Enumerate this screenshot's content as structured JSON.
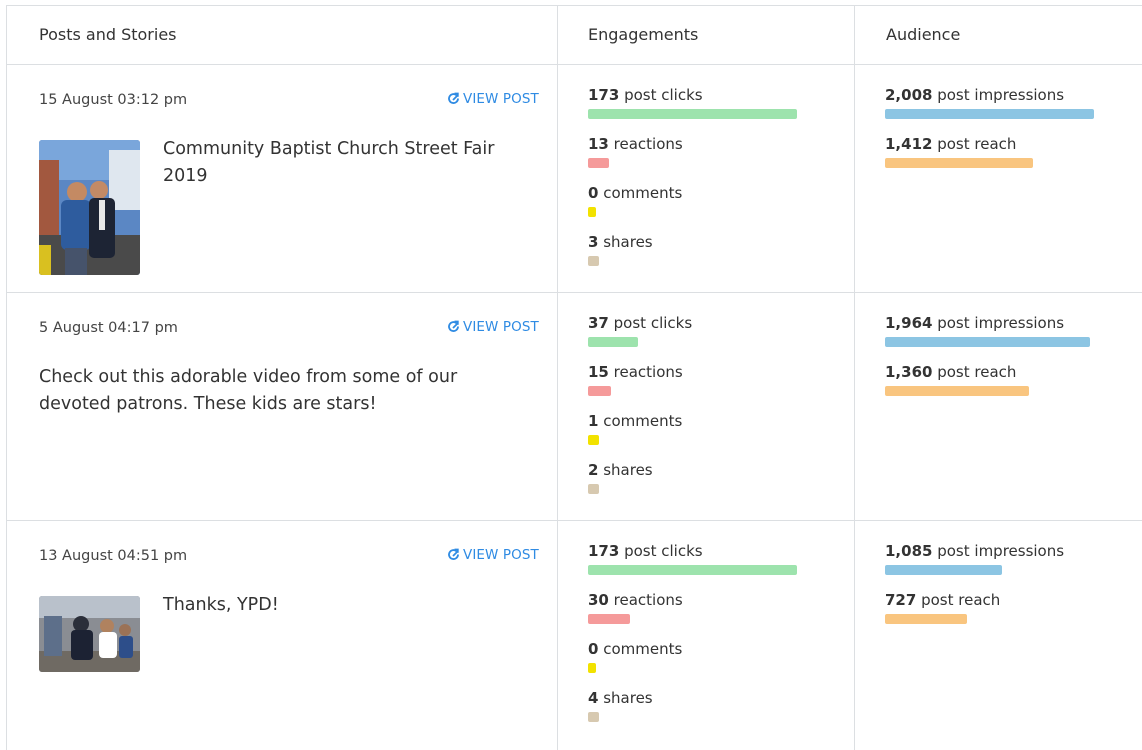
{
  "headers": {
    "posts": "Posts and Stories",
    "engagements": "Engagements",
    "audience": "Audience"
  },
  "colors": {
    "clicks": "#9de3ad",
    "reactions": "#f59a9a",
    "comments": "#f2e200",
    "shares": "#d7c9b0",
    "impressions": "#8cc5e3",
    "reach": "#f9c57f",
    "link": "#2f8be3"
  },
  "view_post_label": "VIEW POST",
  "rows": [
    {
      "date": "15 August 03:12 pm",
      "text": "Community Baptist Church Street Fair 2019",
      "thumb_icon": "photo-two-men-street-fair",
      "engagements": [
        {
          "value": "173",
          "label": "post clicks",
          "fraction": 1.0
        },
        {
          "value": "13",
          "label": "reactions",
          "fraction": 0.1
        },
        {
          "value": "0",
          "label": "comments",
          "fraction": 0.0
        },
        {
          "value": "3",
          "label": "shares",
          "fraction": 0.02
        }
      ],
      "audience": [
        {
          "value": "2,008",
          "label": "post impressions",
          "fraction": 1.0
        },
        {
          "value": "1,412",
          "label": "post reach",
          "fraction": 0.71
        }
      ]
    },
    {
      "date": "5 August 04:17 pm",
      "text": "Check out this adorable video from some of our devoted patrons. These kids are stars!",
      "thumb_icon": "",
      "engagements": [
        {
          "value": "37",
          "label": "post clicks",
          "fraction": 0.24
        },
        {
          "value": "15",
          "label": "reactions",
          "fraction": 0.11
        },
        {
          "value": "1",
          "label": "comments",
          "fraction": 0.01
        },
        {
          "value": "2",
          "label": "shares",
          "fraction": 0.02
        }
      ],
      "audience": [
        {
          "value": "1,964",
          "label": "post impressions",
          "fraction": 0.98
        },
        {
          "value": "1,360",
          "label": "post reach",
          "fraction": 0.69
        }
      ]
    },
    {
      "date": "13 August 04:51 pm",
      "text": "Thanks, YPD!",
      "thumb_icon": "photo-officer-with-kids",
      "engagements": [
        {
          "value": "173",
          "label": "post clicks",
          "fraction": 1.0
        },
        {
          "value": "30",
          "label": "reactions",
          "fraction": 0.2
        },
        {
          "value": "0",
          "label": "comments",
          "fraction": 0.0
        },
        {
          "value": "4",
          "label": "shares",
          "fraction": 0.03
        }
      ],
      "audience": [
        {
          "value": "1,085",
          "label": "post impressions",
          "fraction": 0.56
        },
        {
          "value": "727",
          "label": "post reach",
          "fraction": 0.39
        }
      ]
    }
  ]
}
